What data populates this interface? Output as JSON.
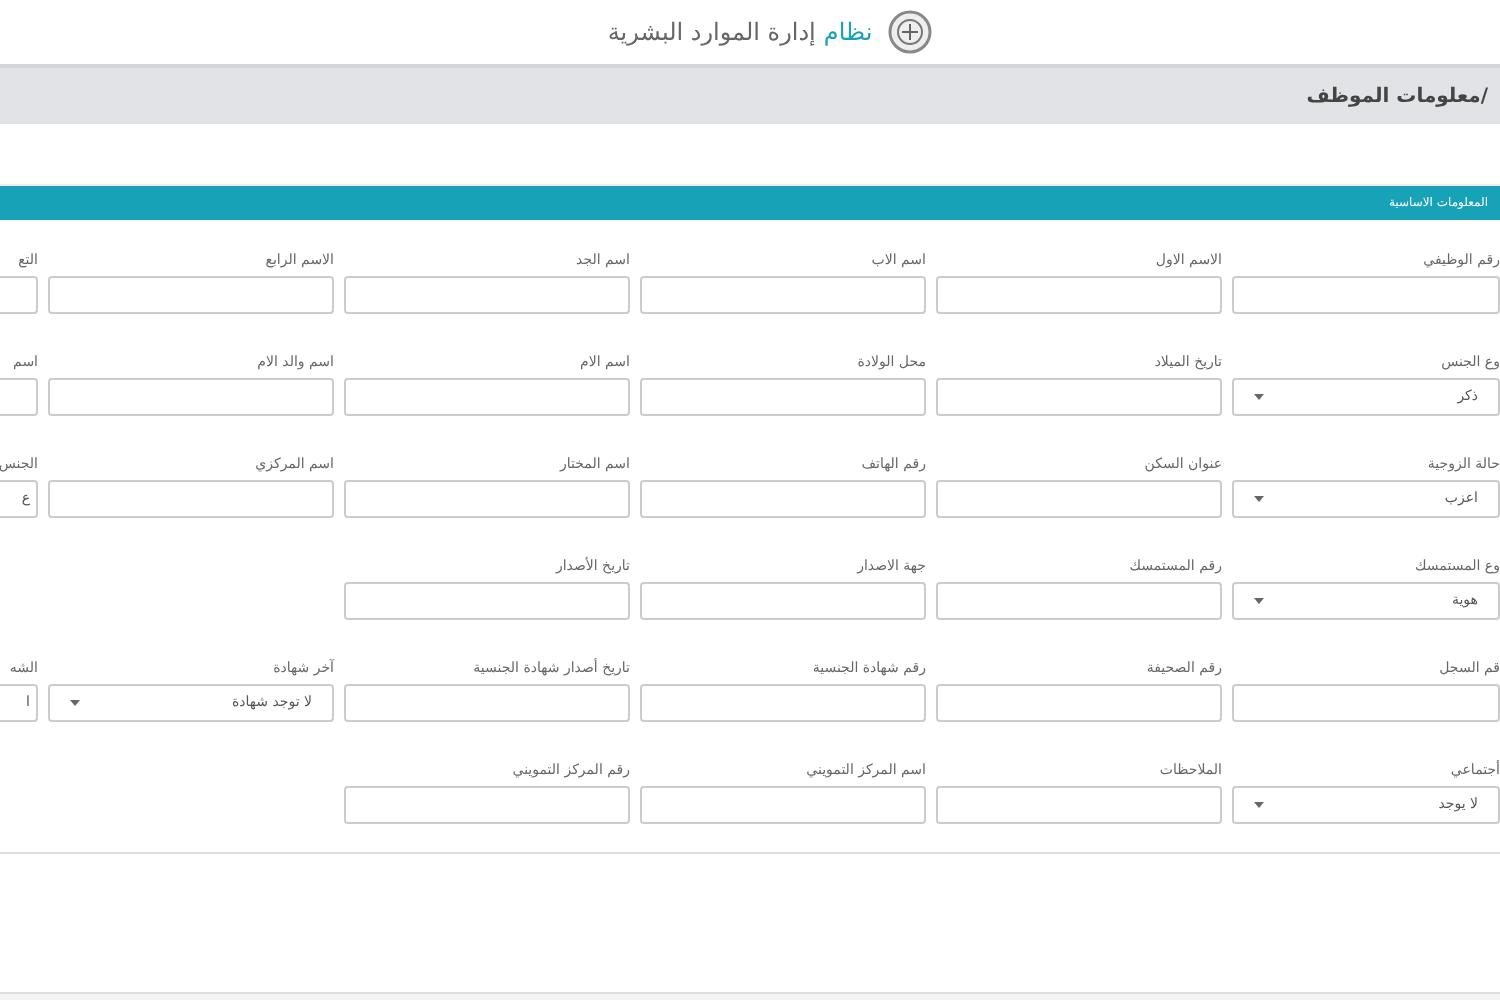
{
  "header": {
    "title_accent": "نظام",
    "title_rest": "إدارة الموارد البشرية"
  },
  "breadcrumb": "/معلومات الموظف",
  "section": {
    "title": "المعلومات الاساسية"
  },
  "rows": [
    [
      {
        "label": "رقم الوظيفي",
        "kind": "text"
      },
      {
        "label": "الاسم الاول",
        "kind": "text"
      },
      {
        "label": "اسم الاب",
        "kind": "text"
      },
      {
        "label": "اسم الجد",
        "kind": "text"
      },
      {
        "label": "الاسم الرابع",
        "kind": "text"
      },
      {
        "label": "التع",
        "kind": "text"
      }
    ],
    [
      {
        "label": "وع الجنس",
        "kind": "select",
        "value": "ذكر"
      },
      {
        "label": "تاريخ الميلاد",
        "kind": "text"
      },
      {
        "label": "محل الولادة",
        "kind": "text"
      },
      {
        "label": "اسم الام",
        "kind": "text"
      },
      {
        "label": "اسم والد الام",
        "kind": "text"
      },
      {
        "label": "اسم",
        "kind": "text"
      }
    ],
    [
      {
        "label": "حالة الزوجية",
        "kind": "select",
        "value": "اعزب"
      },
      {
        "label": "عنوان السكن",
        "kind": "text"
      },
      {
        "label": "رقم الهاتف",
        "kind": "text"
      },
      {
        "label": "اسم المختار",
        "kind": "text"
      },
      {
        "label": "اسم المركزي",
        "kind": "text"
      },
      {
        "label": "الجنس",
        "kind": "text",
        "value": "ع"
      }
    ],
    [
      {
        "label": "وع المستمسك",
        "kind": "select",
        "value": "هوية"
      },
      {
        "label": "رقم المستمسك",
        "kind": "text"
      },
      {
        "label": "جهة الاصدار",
        "kind": "text"
      },
      {
        "label": "تاريخ الأصدار",
        "kind": "text"
      },
      {
        "kind": "empty"
      },
      {
        "kind": "empty"
      }
    ],
    [
      {
        "label": "قم السجل",
        "kind": "text"
      },
      {
        "label": "رقم الصحيفة",
        "kind": "text"
      },
      {
        "label": "رقم شهادة الجنسية",
        "kind": "text"
      },
      {
        "label": "تاريخ أصدار شهادة الجنسية",
        "kind": "text"
      },
      {
        "label": "آخر شهادة",
        "kind": "select",
        "value": "لا توجد شهادة"
      },
      {
        "label": "الشه",
        "kind": "text",
        "value": "ا"
      }
    ],
    [
      {
        "label": "أجتماعي",
        "kind": "select",
        "value": "لا يوجد"
      },
      {
        "label": "الملاحظات",
        "kind": "text"
      },
      {
        "label": "اسم المركز التمويني",
        "kind": "text"
      },
      {
        "label": "رقم المركز التمويني",
        "kind": "text"
      },
      {
        "kind": "empty"
      },
      {
        "kind": "empty"
      }
    ]
  ]
}
